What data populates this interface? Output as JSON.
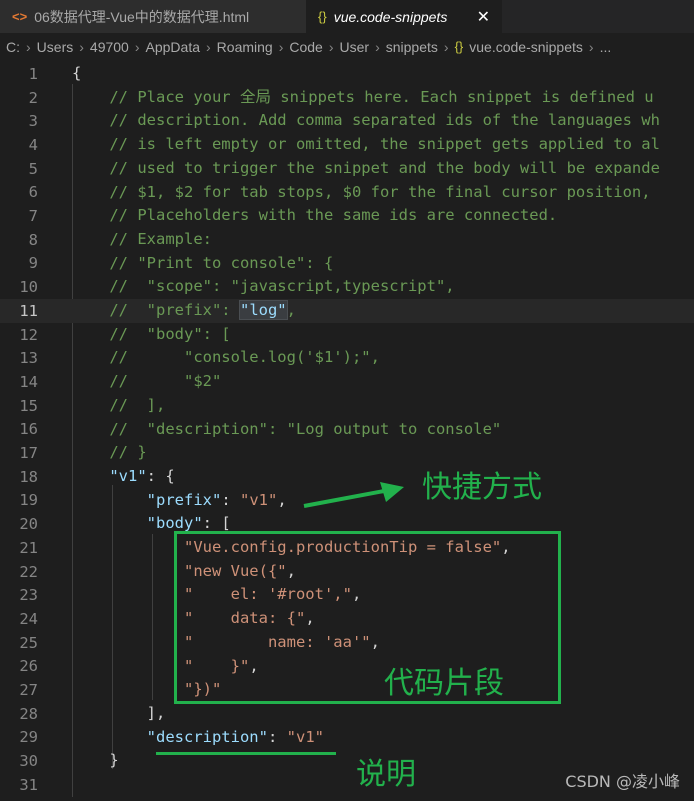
{
  "tabs": [
    {
      "icon": "<>",
      "label": "06数据代理-Vue中的数据代理.html",
      "active": false
    },
    {
      "icon": "{}",
      "label": "vue.code-snippets",
      "active": true,
      "close": "✕"
    }
  ],
  "breadcrumb": [
    "C:",
    "Users",
    "49700",
    "AppData",
    "Roaming",
    "Code",
    "User",
    "snippets",
    "vue.code-snippets",
    "..."
  ],
  "editor": {
    "current_line": 11,
    "lines": [
      {
        "n": "1",
        "t": [
          [
            "p",
            "{"
          ]
        ]
      },
      {
        "n": "2",
        "t": [
          [
            "c",
            "    // Place your 全局 snippets here. Each snippet is defined u"
          ]
        ]
      },
      {
        "n": "3",
        "t": [
          [
            "c",
            "    // description. Add comma separated ids of the languages wh"
          ]
        ]
      },
      {
        "n": "4",
        "t": [
          [
            "c",
            "    // is left empty or omitted, the snippet gets applied to al"
          ]
        ]
      },
      {
        "n": "5",
        "t": [
          [
            "c",
            "    // used to trigger the snippet and the body will be expande"
          ]
        ]
      },
      {
        "n": "6",
        "t": [
          [
            "c",
            "    // $1, $2 for tab stops, $0 for the final cursor position, "
          ]
        ]
      },
      {
        "n": "7",
        "t": [
          [
            "c",
            "    // Placeholders with the same ids are connected."
          ]
        ]
      },
      {
        "n": "8",
        "t": [
          [
            "c",
            "    // Example:"
          ]
        ]
      },
      {
        "n": "9",
        "t": [
          [
            "c",
            "    // \"Print to console\": {"
          ]
        ]
      },
      {
        "n": "10",
        "t": [
          [
            "c",
            "    //  \"scope\": \"javascript,typescript\","
          ]
        ]
      },
      {
        "n": "11",
        "t": [
          [
            "c",
            "    //  \"prefix\": "
          ],
          [
            "hl",
            "\"log\""
          ],
          [
            "c",
            ","
          ]
        ]
      },
      {
        "n": "12",
        "t": [
          [
            "c",
            "    //  \"body\": ["
          ]
        ]
      },
      {
        "n": "13",
        "t": [
          [
            "c",
            "    //      \"console.log('$1');\","
          ]
        ]
      },
      {
        "n": "14",
        "t": [
          [
            "c",
            "    //      \"$2\""
          ]
        ]
      },
      {
        "n": "15",
        "t": [
          [
            "c",
            "    //  ],"
          ]
        ]
      },
      {
        "n": "16",
        "t": [
          [
            "c",
            "    //  \"description\": \"Log output to console\""
          ]
        ]
      },
      {
        "n": "17",
        "t": [
          [
            "c",
            "    // }"
          ]
        ]
      },
      {
        "n": "18",
        "t": [
          [
            "p",
            "    "
          ],
          [
            "k",
            "\"v1\""
          ],
          [
            "p",
            ": {"
          ]
        ]
      },
      {
        "n": "19",
        "t": [
          [
            "p",
            "        "
          ],
          [
            "k",
            "\"prefix\""
          ],
          [
            "p",
            ": "
          ],
          [
            "s",
            "\"v1\""
          ],
          [
            "p",
            ","
          ]
        ]
      },
      {
        "n": "20",
        "t": [
          [
            "p",
            "        "
          ],
          [
            "k",
            "\"body\""
          ],
          [
            "p",
            ": ["
          ]
        ]
      },
      {
        "n": "21",
        "t": [
          [
            "p",
            "            "
          ],
          [
            "s",
            "\"Vue.config.productionTip = false\""
          ],
          [
            "p",
            ","
          ]
        ]
      },
      {
        "n": "22",
        "t": [
          [
            "p",
            "            "
          ],
          [
            "s",
            "\"new Vue({\""
          ],
          [
            "p",
            ","
          ]
        ]
      },
      {
        "n": "23",
        "t": [
          [
            "p",
            "            "
          ],
          [
            "s",
            "\"    el: '#root',\""
          ],
          [
            "p",
            ","
          ]
        ]
      },
      {
        "n": "24",
        "t": [
          [
            "p",
            "            "
          ],
          [
            "s",
            "\"    data: {\""
          ],
          [
            "p",
            ","
          ]
        ]
      },
      {
        "n": "25",
        "t": [
          [
            "p",
            "            "
          ],
          [
            "s",
            "\"        name: 'aa'\""
          ],
          [
            "p",
            ","
          ]
        ]
      },
      {
        "n": "26",
        "t": [
          [
            "p",
            "            "
          ],
          [
            "s",
            "\"    }\""
          ],
          [
            "p",
            ","
          ]
        ]
      },
      {
        "n": "27",
        "t": [
          [
            "p",
            "            "
          ],
          [
            "s",
            "\"})\""
          ]
        ]
      },
      {
        "n": "28",
        "t": [
          [
            "p",
            "        ],"
          ]
        ]
      },
      {
        "n": "29",
        "t": [
          [
            "p",
            "        "
          ],
          [
            "k",
            "\"description\""
          ],
          [
            "p",
            ": "
          ],
          [
            "s",
            "\"v1\""
          ]
        ]
      },
      {
        "n": "30",
        "t": [
          [
            "p",
            "    }"
          ]
        ]
      },
      {
        "n": "31",
        "t": [
          [
            "p",
            ""
          ]
        ]
      }
    ]
  },
  "annotations": {
    "shortcut": "快捷方式",
    "snippet": "代码片段",
    "explain": "说明"
  },
  "watermark": "CSDN @凌小峰",
  "colors": {
    "annotation": "#22b14c",
    "comment": "#6a9955",
    "key": "#9cdcfe",
    "string": "#ce9178"
  }
}
